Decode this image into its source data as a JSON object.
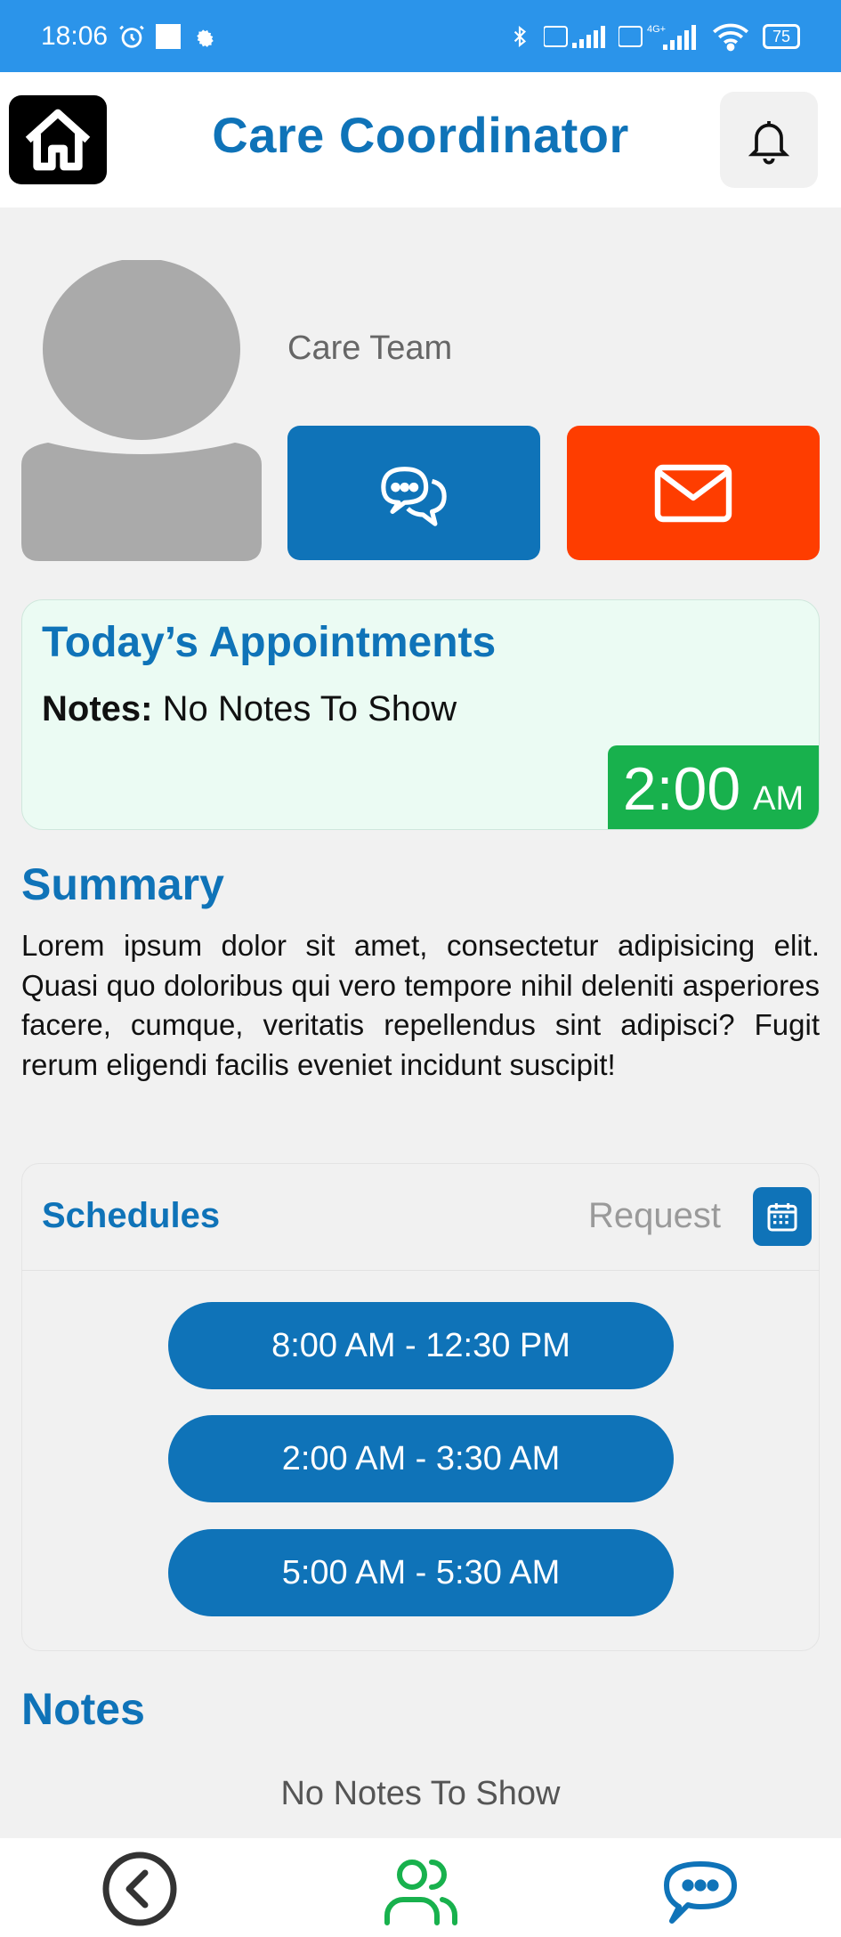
{
  "status_bar": {
    "time": "18:06",
    "battery": "75",
    "network": "4G+"
  },
  "header": {
    "title": "Care Coordinator"
  },
  "profile": {
    "team_label": "Care Team"
  },
  "appointment": {
    "title": "Today’s Appointments",
    "notes_label": "Notes:",
    "notes_value": "No Notes To Show",
    "time": "2:00",
    "meridiem": "AM"
  },
  "summary": {
    "title": "Summary",
    "text": "Lorem ipsum dolor sit amet, consectetur adipisicing elit. Quasi quo doloribus qui vero tempore nihil deleniti asperiores facere, cumque, veritatis repellendus sint adipisci? Fugit rerum eligendi facilis eveniet incidunt suscipit!"
  },
  "schedules": {
    "title": "Schedules",
    "request_label": "Request",
    "slots": [
      "8:00 AM - 12:30 PM",
      "2:00 AM - 3:30 AM",
      "5:00 AM - 5:30 AM"
    ]
  },
  "notes": {
    "title": "Notes",
    "empty_text": "No Notes To Show"
  },
  "colors": {
    "primary": "#0f73b8",
    "status_bar": "#2b94ea",
    "mail": "#fe3d00",
    "time_badge": "#18b14d",
    "appointment_bg": "#ebfbf3"
  },
  "icons": {
    "home": "home-icon",
    "bell": "bell-icon",
    "chat": "chat-bubbles-icon",
    "mail": "mail-icon",
    "calendar": "calendar-icon",
    "back": "back-chevron-icon",
    "people": "people-icon",
    "messages": "messages-icon"
  }
}
